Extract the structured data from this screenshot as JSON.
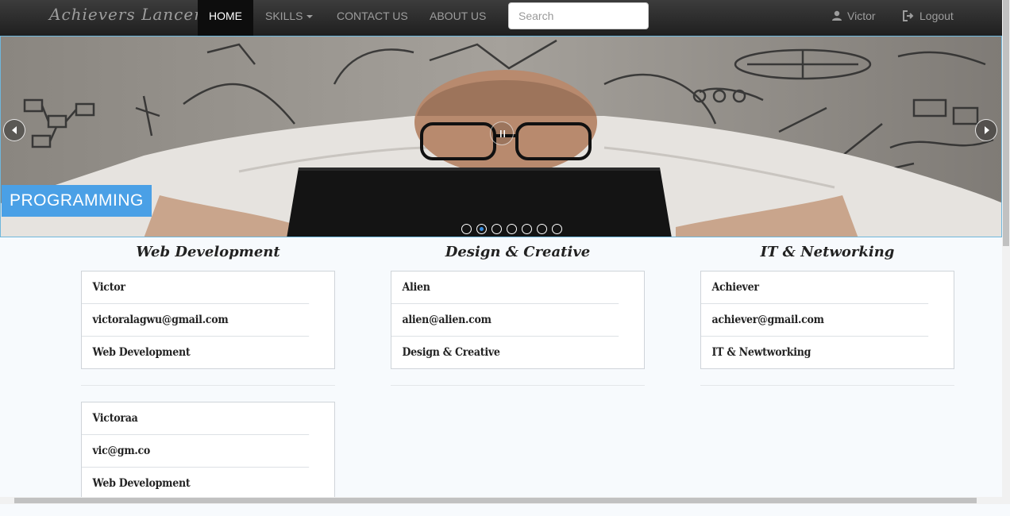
{
  "navbar": {
    "brand": "Achievers Lancer",
    "items": [
      {
        "label": "HOME",
        "active": true
      },
      {
        "label": "SKILLS",
        "has_dropdown": true
      },
      {
        "label": "CONTACT US"
      },
      {
        "label": "ABOUT US"
      }
    ],
    "search": {
      "placeholder": "Search",
      "value": ""
    },
    "user": {
      "label": "Victor",
      "icon": "user-icon"
    },
    "logout": {
      "label": "Logout",
      "icon": "logout-icon"
    }
  },
  "carousel": {
    "caption": "PROGRAMMING",
    "slide_count": 7,
    "active_index": 1,
    "controls": [
      "prev-arrow-icon",
      "pause-icon",
      "next-arrow-icon"
    ],
    "caption_color": "#4aa0e6"
  },
  "categories": [
    {
      "title": "Web Development",
      "cards": [
        {
          "name": "Victor",
          "email": "victoralagwu@gmail.com",
          "skill": "Web Development"
        },
        {
          "name": "Victoraa",
          "email": "vic@gm.co",
          "skill": "Web Development"
        }
      ]
    },
    {
      "title": "Design & Creative",
      "cards": [
        {
          "name": "Alien",
          "email": "alien@alien.com",
          "skill": "Design & Creative"
        }
      ]
    },
    {
      "title": "IT & Networking",
      "cards": [
        {
          "name": "Achiever",
          "email": "achiever@gmail.com",
          "skill": "IT & Newtworking"
        }
      ]
    }
  ]
}
